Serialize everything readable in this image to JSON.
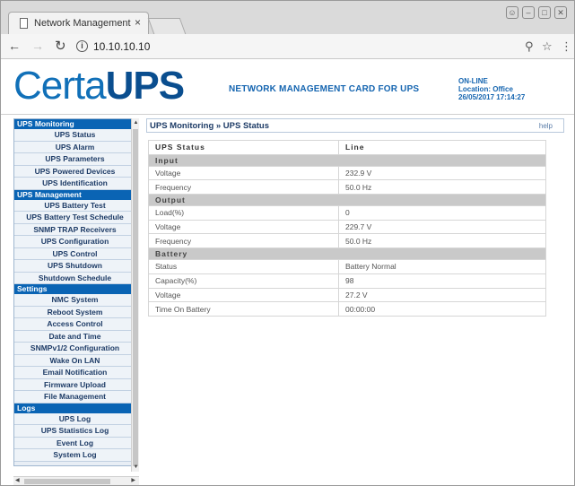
{
  "browser": {
    "tab_title": "Network Management C",
    "tab_close": "×",
    "url": "10.10.10.10"
  },
  "header": {
    "logo_a": "Certa",
    "logo_b": "UPS",
    "subtitle": "NETWORK MANAGEMENT CARD FOR UPS",
    "status": "ON-LINE",
    "location": "Location: Office",
    "datetime": "26/05/2017 17:14:27"
  },
  "sidebar": [
    {
      "section": "UPS Monitoring",
      "items": [
        "UPS Status",
        "UPS Alarm",
        "UPS Parameters",
        "UPS Powered Devices",
        "UPS Identification"
      ]
    },
    {
      "section": "UPS Management",
      "items": [
        "UPS Battery Test",
        "UPS Battery Test Schedule",
        "SNMP TRAP Receivers",
        "UPS Configuration",
        "UPS Control",
        "UPS Shutdown",
        "Shutdown Schedule"
      ]
    },
    {
      "section": "Settings",
      "items": [
        "NMC System",
        "Reboot System",
        "Access Control",
        "Date and Time",
        "SNMPv1/2 Configuration",
        "Wake On LAN",
        "Email Notification",
        "Firmware Upload",
        "File Management"
      ]
    },
    {
      "section": "Logs",
      "items": [
        "UPS Log",
        "UPS Statistics Log",
        "Event Log",
        "System Log"
      ]
    }
  ],
  "main": {
    "breadcrumb": "UPS Monitoring » UPS Status",
    "help": "help",
    "table": {
      "headers": [
        "UPS Status",
        "Line"
      ],
      "groups": [
        {
          "name": "Input",
          "rows": [
            [
              "Voltage",
              "232.9 V"
            ],
            [
              "Frequency",
              "50.0 Hz"
            ]
          ]
        },
        {
          "name": "Output",
          "rows": [
            [
              "Load(%)",
              "0"
            ],
            [
              "Voltage",
              "229.7 V"
            ],
            [
              "Frequency",
              "50.0 Hz"
            ]
          ]
        },
        {
          "name": "Battery",
          "rows": [
            [
              "Status",
              "Battery Normal"
            ],
            [
              "Capacity(%)",
              "98"
            ],
            [
              "Voltage",
              "27.2 V"
            ],
            [
              "Time On Battery",
              "00:00:00"
            ]
          ]
        }
      ]
    }
  }
}
